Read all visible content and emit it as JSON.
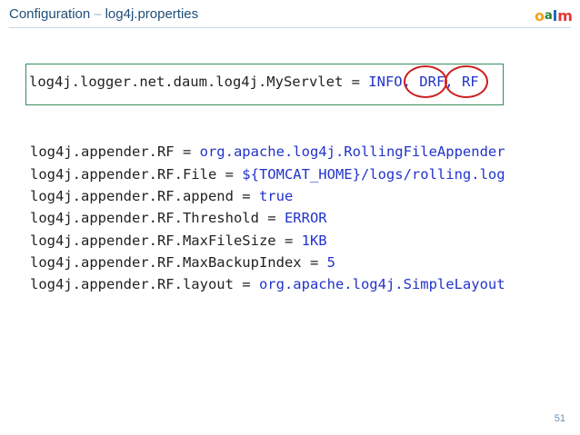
{
  "header": {
    "title_main": "Configuration",
    "title_sep": "–",
    "title_sub": "log4j.properties",
    "logo": [
      "o",
      "a",
      "l",
      "m"
    ]
  },
  "top_line": {
    "prefix": "log4j.logger.net.daum.log4j.MyServlet = ",
    "level": "INFO,",
    "appender1": "DRF,",
    "appender2": "RF"
  },
  "appender_lines": [
    {
      "key": "log4j.appender.RF = ",
      "value": "org.apache.log4j.RollingFileAppender"
    },
    {
      "key": "log4j.appender.RF.File = ",
      "value": "${TOMCAT_HOME}/logs/rolling.log"
    },
    {
      "key": "log4j.appender.RF.append = ",
      "value": "true"
    },
    {
      "key": "log4j.appender.RF.Threshold = ",
      "value": "ERROR"
    },
    {
      "key": "log4j.appender.RF.MaxFileSize = ",
      "value": "1KB"
    },
    {
      "key": "log4j.appender.RF.MaxBackupIndex = ",
      "value": "5"
    },
    {
      "key": "log4j.appender.RF.layout = ",
      "value": "org.apache.log4j.SimpleLayout"
    }
  ],
  "page_number": "51",
  "colors": {
    "title": "#1f4e79",
    "keyword": "#2233cc",
    "highlight_circle": "#cc1f1f",
    "box_border": "#3a8c5a"
  }
}
